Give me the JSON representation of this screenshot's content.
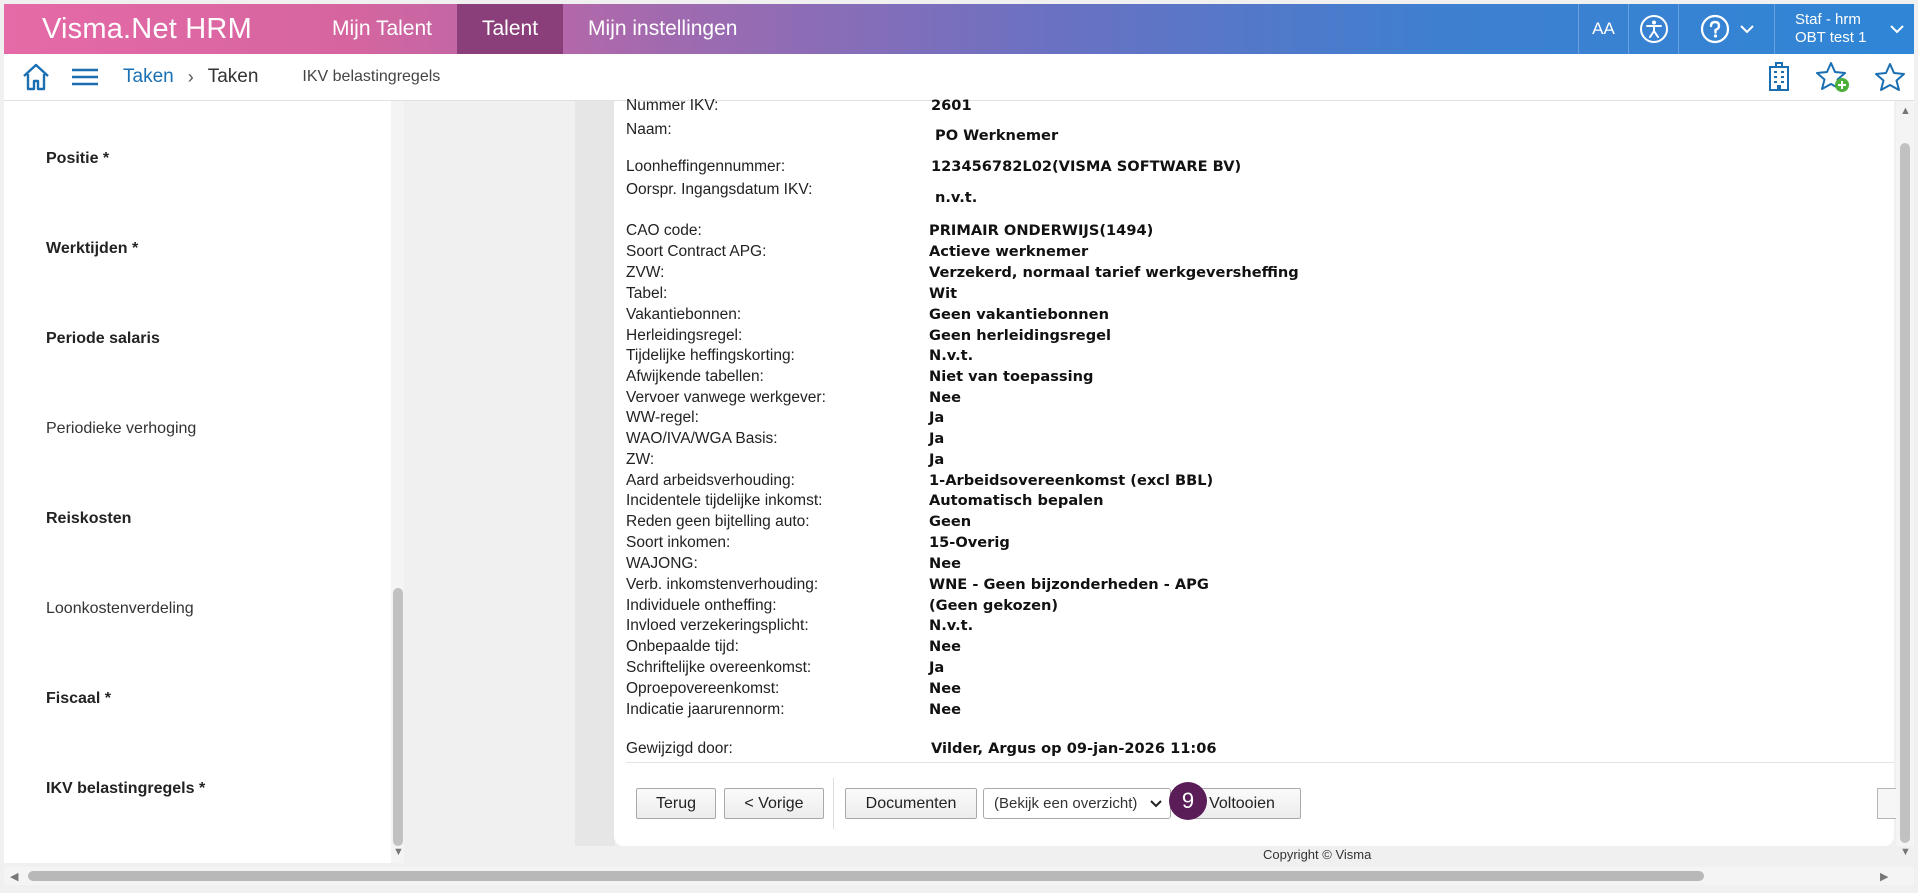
{
  "header": {
    "brand": "Visma.Net HRM",
    "nav": [
      {
        "label": "Mijn Talent"
      },
      {
        "label": "Talent"
      },
      {
        "label": "Mijn instellingen"
      }
    ],
    "font_size_label": "AA",
    "user": {
      "line1": "Staf - hrm",
      "line2": "OBT test 1"
    },
    "colors": {
      "active_tab": "#8a3f7a",
      "brand_start": "#e56aa7",
      "brand_end": "#2f86d6"
    }
  },
  "breadcrumb": {
    "level1": "Taken",
    "separator": "›",
    "level2": "Taken",
    "page": "IKV belastingregels"
  },
  "sidebar": {
    "items": [
      {
        "label": "Positie *"
      },
      {
        "label": "Werktijden *"
      },
      {
        "label": "Periode salaris"
      },
      {
        "label": "Periodieke verhoging"
      },
      {
        "label": "Reiskosten"
      },
      {
        "label": "Loonkostenverdeling"
      },
      {
        "label": "Fiscaal *"
      },
      {
        "label": "IKV belastingregels *"
      }
    ]
  },
  "details": {
    "rows": [
      {
        "label": "Nummer IKV:",
        "value": "2601"
      },
      {
        "label": "Naam:",
        "value": "PO Werknemer"
      },
      {
        "label": "Loonheffingennummer:",
        "value": "123456782L02(VISMA SOFTWARE BV)"
      },
      {
        "label": "Oorspr. Ingangsdatum IKV:",
        "value": "n.v.t."
      },
      {
        "label": "CAO code:",
        "value": "PRIMAIR ONDERWIJS(1494)"
      },
      {
        "label": "Soort Contract APG:",
        "value": "Actieve werknemer"
      },
      {
        "label": "ZVW:",
        "value": "Verzekerd, normaal tarief werkgeversheffing"
      },
      {
        "label": "Tabel:",
        "value": "Wit"
      },
      {
        "label": "Vakantiebonnen:",
        "value": "Geen vakantiebonnen"
      },
      {
        "label": "Herleidingsregel:",
        "value": "Geen herleidingsregel"
      },
      {
        "label": "Tijdelijke heffingskorting:",
        "value": "N.v.t."
      },
      {
        "label": "Afwijkende tabellen:",
        "value": "Niet van toepassing"
      },
      {
        "label": "Vervoer vanwege werkgever:",
        "value": "Nee"
      },
      {
        "label": "WW-regel:",
        "value": "Ja"
      },
      {
        "label": "WAO/IVA/WGA Basis:",
        "value": "Ja"
      },
      {
        "label": "ZW:",
        "value": "Ja"
      },
      {
        "label": "Aard arbeidsverhouding:",
        "value": "1-Arbeidsovereenkomst (excl BBL)"
      },
      {
        "label": "Incidentele tijdelijke inkomst:",
        "value": "Automatisch bepalen"
      },
      {
        "label": "Reden geen bijtelling auto:",
        "value": "Geen"
      },
      {
        "label": "Soort inkomen:",
        "value": "15-Overig"
      },
      {
        "label": "WAJONG:",
        "value": "Nee"
      },
      {
        "label": "Verb. inkomstenverhouding:",
        "value": "WNE - Geen bijzonderheden - APG"
      },
      {
        "label": "Individuele ontheffing:",
        "value": "(Geen gekozen)"
      },
      {
        "label": "Invloed verzekeringsplicht:",
        "value": "N.v.t."
      },
      {
        "label": "Onbepaalde tijd:",
        "value": "Nee"
      },
      {
        "label": "Schriftelijke overeenkomst:",
        "value": "Ja"
      },
      {
        "label": "Oproepovereenkomst:",
        "value": "Nee"
      },
      {
        "label": "Indicatie jaarurennorm:",
        "value": "Nee"
      },
      {
        "label": "Gewijzigd door:",
        "value": "Vilder, Argus op 09-jan-2026 11:06"
      }
    ]
  },
  "buttons": {
    "back": "Terug",
    "previous": "< Vorige",
    "documents": "Documenten",
    "overview_select": "(Bekijk een overzicht)",
    "step_number": "9",
    "complete": "Voltooien"
  },
  "footer": {
    "copyright": "Copyright © Visma"
  }
}
